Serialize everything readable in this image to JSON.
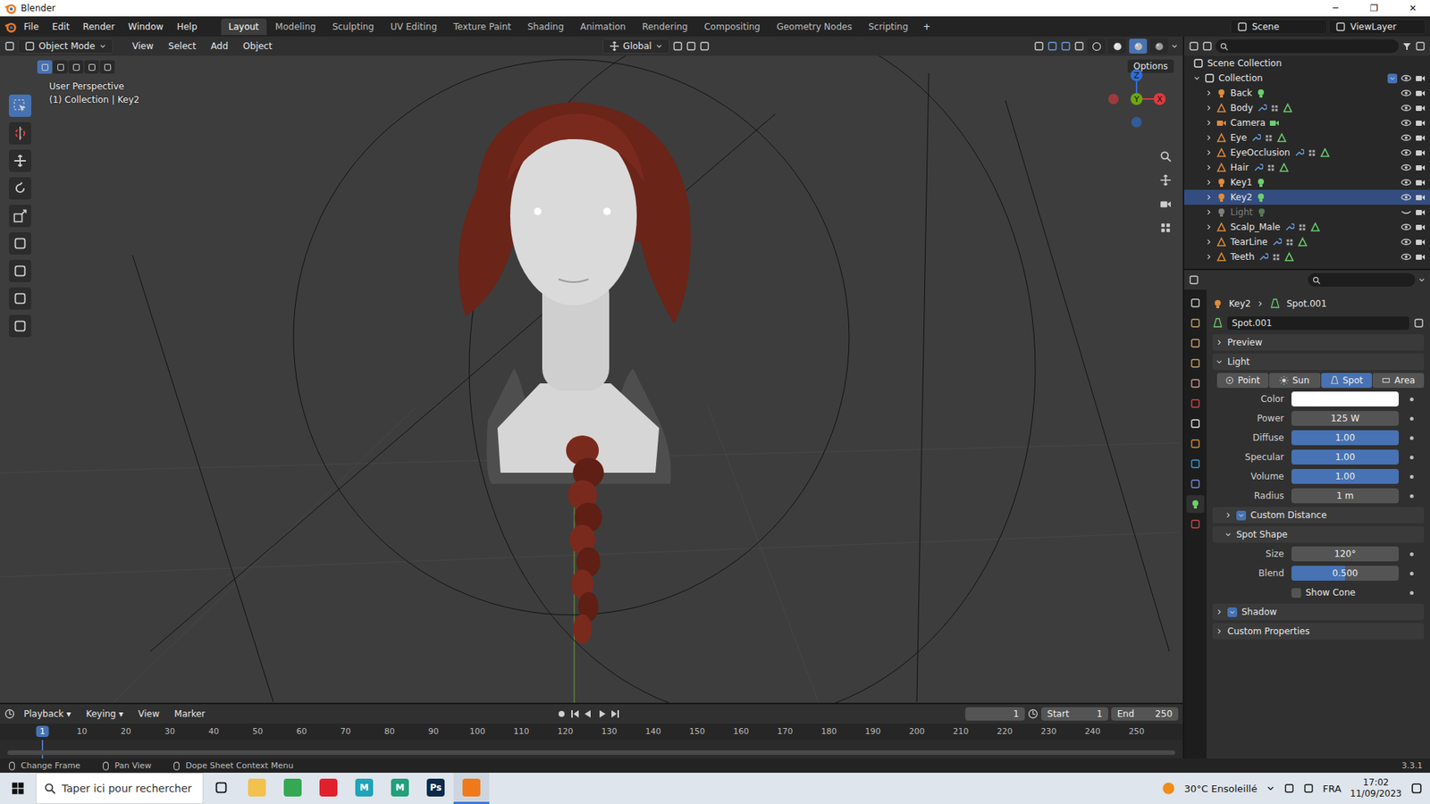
{
  "window": {
    "title": "Blender",
    "controls": [
      "─",
      "❐",
      "✕"
    ]
  },
  "menus": [
    "File",
    "Edit",
    "Render",
    "Window",
    "Help"
  ],
  "workspaces": [
    {
      "label": "Layout",
      "selected": true
    },
    {
      "label": "Modeling",
      "selected": false
    },
    {
      "label": "Sculpting",
      "selected": false
    },
    {
      "label": "UV Editing",
      "selected": false
    },
    {
      "label": "Texture Paint",
      "selected": false
    },
    {
      "label": "Shading",
      "selected": false
    },
    {
      "label": "Animation",
      "selected": false
    },
    {
      "label": "Rendering",
      "selected": false
    },
    {
      "label": "Compositing",
      "selected": false
    },
    {
      "label": "Geometry Nodes",
      "selected": false
    },
    {
      "label": "Scripting",
      "selected": false
    }
  ],
  "add_workspace": "+",
  "scene": "Scene",
  "view_layer": "ViewLayer",
  "viewport": {
    "mode": "Object Mode",
    "menus": [
      "View",
      "Select",
      "Add",
      "Object"
    ],
    "orientation": "Global",
    "options": "Options",
    "info": [
      "User Perspective",
      "(1) Collection | Key2"
    ],
    "select_modes": [
      {
        "selected": true
      },
      {
        "selected": false
      },
      {
        "selected": false
      },
      {
        "selected": false
      },
      {
        "selected": false
      }
    ],
    "shading": [
      {
        "kind": "wireframe",
        "selected": false
      },
      {
        "kind": "solid",
        "selected": false
      },
      {
        "kind": "material",
        "selected": true
      },
      {
        "kind": "rendered",
        "selected": false
      }
    ],
    "tools": [
      {
        "kind": "select",
        "selected": true
      },
      {
        "kind": "cursor",
        "selected": false
      },
      {
        "kind": "move",
        "selected": false
      },
      {
        "kind": "rotate",
        "selected": false
      },
      {
        "kind": "scale",
        "selected": false
      },
      {
        "kind": "transform",
        "selected": false
      },
      {
        "kind": "annotate",
        "selected": false
      },
      {
        "kind": "measure",
        "selected": false
      },
      {
        "kind": "add-cube",
        "selected": false
      }
    ],
    "gizmo": [
      {
        "label": "Z",
        "color": "#2f6fd6"
      },
      {
        "label": "Y",
        "color": "#6ca80e"
      },
      {
        "label": "X",
        "color": "#e0393e"
      }
    ]
  },
  "outliner": {
    "root": "Scene Collection",
    "collection": {
      "label": "Collection",
      "checked": true
    },
    "objects": [
      {
        "name": "Back",
        "kind": "light",
        "visible": true,
        "selected": false
      },
      {
        "name": "Body",
        "kind": "mesh",
        "visible": true,
        "selected": false
      },
      {
        "name": "Camera",
        "kind": "camera",
        "visible": true,
        "selected": false
      },
      {
        "name": "Eye",
        "kind": "mesh",
        "visible": true,
        "selected": false
      },
      {
        "name": "EyeOcclusion",
        "kind": "mesh",
        "visible": true,
        "selected": false
      },
      {
        "name": "Hair",
        "kind": "mesh",
        "visible": true,
        "selected": false
      },
      {
        "name": "Key1",
        "kind": "light",
        "visible": true,
        "selected": false
      },
      {
        "name": "Key2",
        "kind": "light",
        "visible": true,
        "selected": true
      },
      {
        "name": "Light",
        "kind": "light",
        "visible": false,
        "selected": false
      },
      {
        "name": "Scalp_Male",
        "kind": "mesh",
        "visible": true,
        "selected": false
      },
      {
        "name": "TearLine",
        "kind": "mesh",
        "visible": true,
        "selected": false
      },
      {
        "name": "Teeth",
        "kind": "mesh",
        "visible": true,
        "selected": false
      }
    ]
  },
  "properties": {
    "tabs": [
      {
        "kind": "tool",
        "selected": false
      },
      {
        "kind": "render",
        "selected": false
      },
      {
        "kind": "output",
        "selected": false
      },
      {
        "kind": "view-layer",
        "selected": false
      },
      {
        "kind": "scene",
        "selected": false
      },
      {
        "kind": "world",
        "selected": false
      },
      {
        "kind": "collection",
        "selected": false
      },
      {
        "kind": "object",
        "selected": false
      },
      {
        "kind": "physics",
        "selected": false
      },
      {
        "kind": "constraints",
        "selected": false
      },
      {
        "kind": "data",
        "selected": true
      },
      {
        "kind": "texture",
        "selected": false
      }
    ],
    "breadcrumb": [
      "Key2",
      "Spot.001"
    ],
    "datablock": "Spot.001",
    "rows": [
      {
        "kind": "panel",
        "label": "Preview",
        "expanded": false
      },
      {
        "kind": "panel",
        "label": "Light",
        "expanded": true
      },
      {
        "kind": "segmented",
        "options": [
          {
            "label": "Point",
            "selected": false
          },
          {
            "label": "Sun",
            "selected": false
          },
          {
            "label": "Spot",
            "selected": true
          },
          {
            "label": "Area",
            "selected": false
          }
        ]
      },
      {
        "kind": "color",
        "label": "Color",
        "color": "#ffffff"
      },
      {
        "kind": "field",
        "label": "Power",
        "value": "125 W"
      },
      {
        "kind": "slider",
        "label": "Diffuse",
        "value": "1.00",
        "level": 1
      },
      {
        "kind": "slider",
        "label": "Specular",
        "value": "1.00",
        "level": 1
      },
      {
        "kind": "slider",
        "label": "Volume",
        "value": "1.00",
        "level": 1
      },
      {
        "kind": "field",
        "label": "Radius",
        "value": "1 m"
      },
      {
        "kind": "subpanel",
        "label": "Custom Distance",
        "expanded": false,
        "checked": true
      },
      {
        "kind": "subpanel",
        "label": "Spot Shape",
        "expanded": true
      },
      {
        "kind": "field",
        "label": "Size",
        "value": "120°"
      },
      {
        "kind": "slider",
        "label": "Blend",
        "value": "0.500",
        "level": 0.5
      },
      {
        "kind": "check",
        "label": "Show Cone",
        "checked": false
      },
      {
        "kind": "panel",
        "label": "Shadow",
        "expanded": false,
        "checked": true
      },
      {
        "kind": "panel",
        "label": "Custom Properties",
        "expanded": false
      }
    ]
  },
  "timeline": {
    "menus": [
      "Playback",
      "Keying",
      "View",
      "Marker"
    ],
    "current": "1",
    "start_label": "Start",
    "start": "1",
    "end_label": "End",
    "end": "250",
    "ticks": [
      "1",
      "10",
      "20",
      "30",
      "40",
      "50",
      "60",
      "70",
      "80",
      "90",
      "100",
      "110",
      "120",
      "130",
      "140",
      "150",
      "160",
      "170",
      "180",
      "190",
      "200",
      "210",
      "220",
      "230",
      "240",
      "250"
    ]
  },
  "status": {
    "items": [
      "Change Frame",
      "Pan View",
      "Dope Sheet Context Menu"
    ],
    "version": "3.3.1"
  },
  "taskbar": {
    "search": "Taper ici pour rechercher",
    "weather": "30°C Ensoleillé",
    "lang": "FRA",
    "time": "17:02",
    "date": "11/09/2023",
    "apps": [
      {
        "label": "",
        "color": "#f2c14e",
        "active": false
      },
      {
        "label": "",
        "color": "#34a853",
        "active": false
      },
      {
        "label": "",
        "color": "#e0202c",
        "active": false
      },
      {
        "label": "M",
        "color": "#1fa3b8",
        "active": false
      },
      {
        "label": "M",
        "color": "#20a07a",
        "active": false
      },
      {
        "label": "Ps",
        "color": "#0b2a48",
        "active": false
      },
      {
        "label": "",
        "color": "#f07a1a",
        "active": true
      }
    ]
  }
}
